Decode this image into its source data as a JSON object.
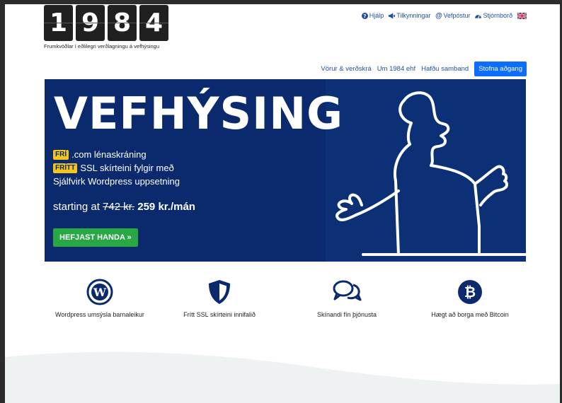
{
  "logo": {
    "digits": [
      "1",
      "9",
      "8",
      "4"
    ],
    "tagline": "Frumkvöðlar í eðlilegri verðlagningu á vefhýsingu"
  },
  "utility_nav": {
    "help": "Hjálp",
    "announcements": "Tilkynningar",
    "webmail": "Vefpóstur",
    "control_panel": "Stjórnborð"
  },
  "main_nav": {
    "products": "Vörur & verðskrá",
    "about": "Um 1984 ehf",
    "contact": "Hafðu samband",
    "signup": "Stofna aðgang"
  },
  "hero": {
    "title": "VEFHÝSING",
    "features": [
      {
        "badge": "FRÍ",
        "text": ".com lénaskráning"
      },
      {
        "badge": "FRÍTT",
        "text": "SSL skírteini fylgir með"
      },
      {
        "badge": "",
        "text": "Sjálfvirk Wordpress uppsetning"
      }
    ],
    "price_prefix": "starting at",
    "old_price": "742 kr.",
    "new_price": "259 kr./mán",
    "cta": "HEFJAST HANDA »"
  },
  "feature_row": [
    {
      "icon": "wordpress-icon",
      "label": "Wordpress umsýsla barnaleikur"
    },
    {
      "icon": "shield-icon",
      "label": "Frítt SSL skírteini innifalið"
    },
    {
      "icon": "chat-bubbles-icon",
      "label": "Skínandi fín þjónusta"
    },
    {
      "icon": "bitcoin-icon",
      "label": "Hægt að borga með Bitcoin"
    }
  ],
  "colors": {
    "hero_bg": "#0b2a6e",
    "accent_blue": "#0d6efd",
    "cta_green": "#28a745",
    "badge_yellow": "#f5c518",
    "link_blue": "#1f4f9c"
  }
}
